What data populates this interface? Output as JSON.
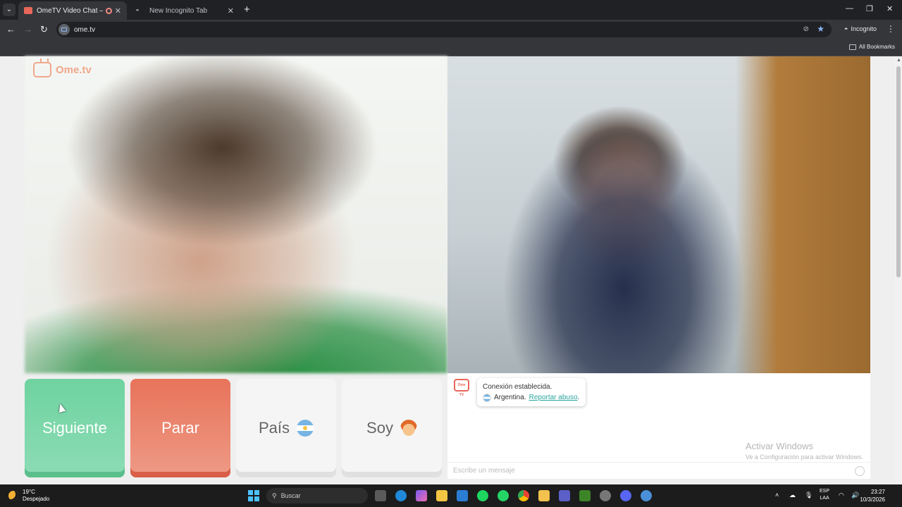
{
  "browser": {
    "tabs": [
      {
        "title": "OmeTV Video Chat — Ome",
        "active": true
      },
      {
        "title": "New Incognito Tab",
        "active": false
      }
    ],
    "url": "ome.tv",
    "incognito_label": "Incognito",
    "bookmarks_label": "All Bookmarks"
  },
  "page": {
    "logo": "Ome.tv",
    "buttons": {
      "next": "Siguiente",
      "stop": "Parar",
      "country": "País",
      "soy": "Soy"
    },
    "chat": {
      "logo_text": "Ome TV",
      "status": "Conexión establecida.",
      "country": "Argentina.",
      "report": "Reportar abuso",
      "report_suffix": ".",
      "placeholder": "Escribe un mensaje"
    },
    "watermark": {
      "title": "Activar Windows",
      "subtitle": "Ve a Configuración para activar Windows."
    }
  },
  "taskbar": {
    "temperature": "19°C",
    "weather": "Despejado",
    "search": "Buscar",
    "lang_top": "ESP",
    "lang_bottom": "LAA",
    "time": "23:27",
    "date": "10/3/2026"
  },
  "colors": {
    "next": "#6fd3a0",
    "stop": "#e8735a",
    "accent": "#2aa6a0"
  }
}
